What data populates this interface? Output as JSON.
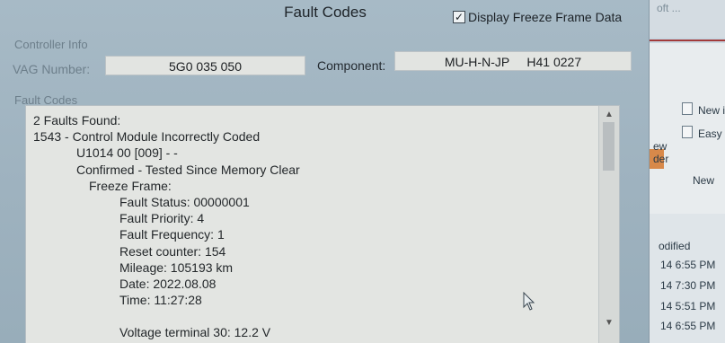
{
  "window": {
    "title": "Fault Codes",
    "freeze_frame_checkbox": {
      "label": "Display Freeze Frame Data",
      "checked": true,
      "mark": "✓"
    }
  },
  "controller_info": {
    "heading": "Controller Info",
    "vag_number_label": "VAG Number:",
    "vag_number_value": "5G0 035 050",
    "component_label": "Component:",
    "component_value": "MU-H-N-JP     H41 0227"
  },
  "fault_codes": {
    "heading": "Fault Codes",
    "lines": {
      "summary": "2 Faults Found:",
      "fault_title": "1543 - Control Module Incorrectly Coded",
      "fault_code": "U1014 00 [009] - -",
      "fault_status": "Confirmed - Tested Since Memory Clear",
      "freeze_frame": "Freeze Frame:",
      "ff_status": "Fault Status: 00000001",
      "ff_priority": "Fault Priority: 4",
      "ff_frequency": "Fault Frequency: 1",
      "ff_reset": "Reset counter: 154",
      "ff_mileage": "Mileage: 105193 km",
      "ff_date": "Date: 2022.08.08",
      "ff_time": "Time: 11:27:28",
      "ff_voltage": "Voltage terminal 30: 12.2 V"
    }
  },
  "scrollbar": {
    "up": "▲",
    "down": "▼"
  },
  "background_app": {
    "title_fragment": "oft ...",
    "new_items": "New i",
    "easy_access": "Easy a",
    "fragment_ew": "ew",
    "fragment_der": "der",
    "new_group": "New",
    "modified_header": "odified",
    "times": [
      "14 6:55 PM",
      "14 7:30 PM",
      "14 5:51 PM",
      "14 6:55 PM"
    ]
  },
  "icons": {
    "checkbox": "check-icon",
    "cursor": "mouse-pointer-icon",
    "scroll_up": "chevron-up-icon",
    "scroll_down": "chevron-down-icon"
  }
}
